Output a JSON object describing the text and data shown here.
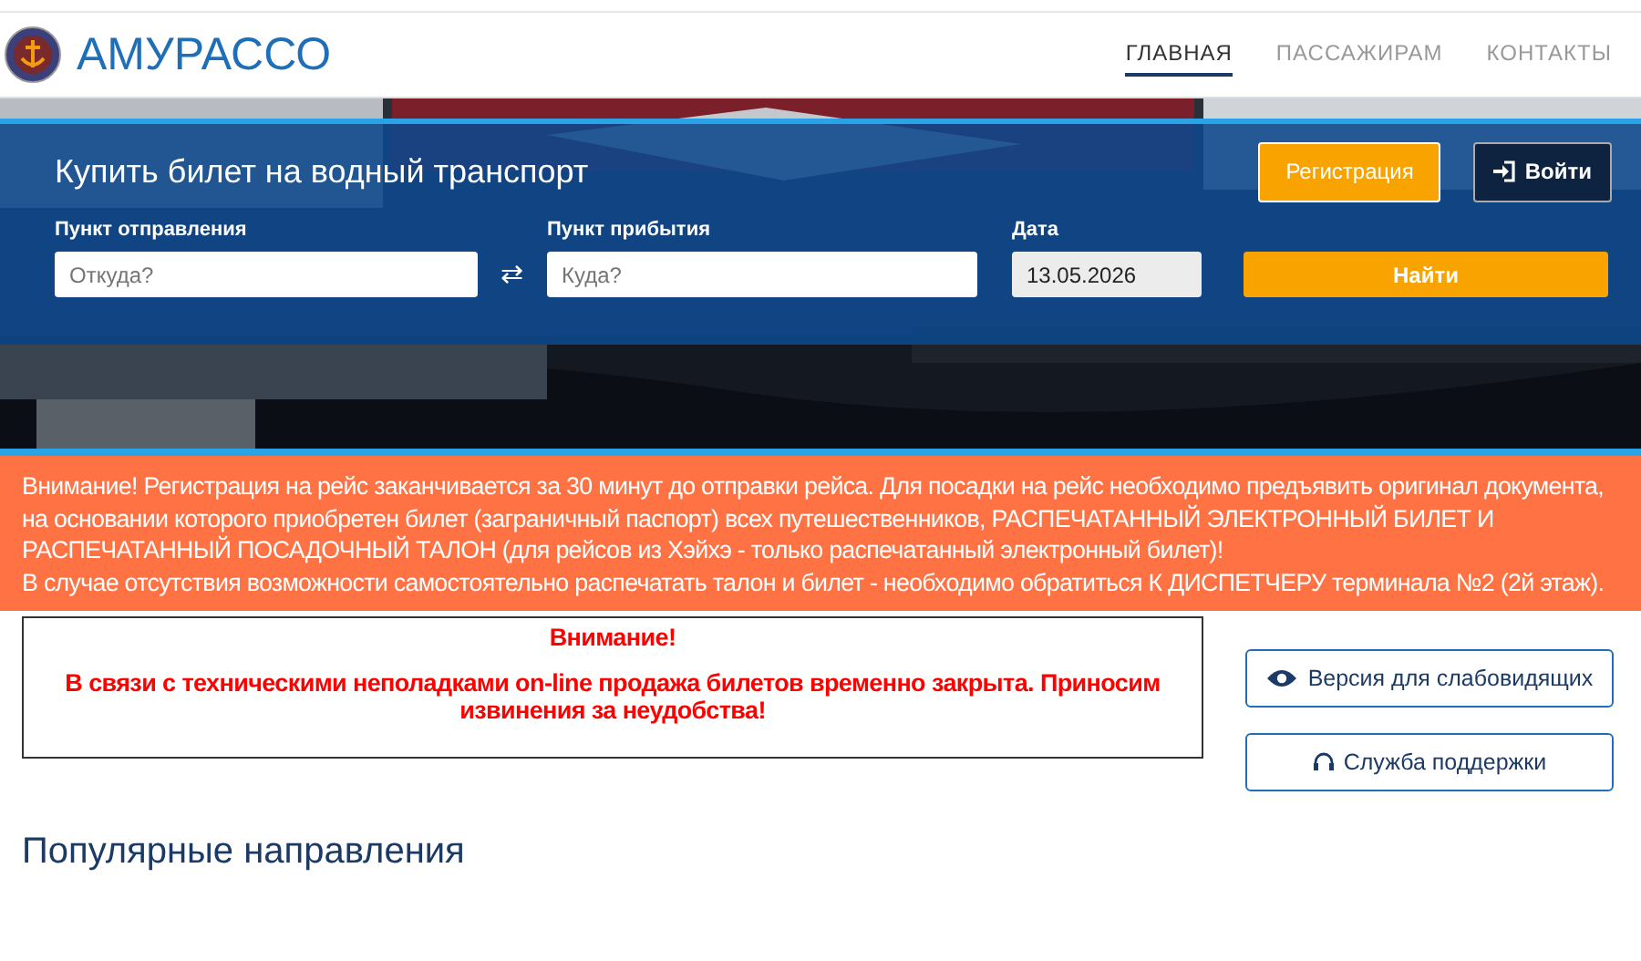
{
  "header": {
    "logo_text": "АМУРАССО",
    "nav": [
      {
        "label": "ГЛАВНАЯ",
        "selected": true
      },
      {
        "label": "ПАССАЖИРАМ",
        "selected": false
      },
      {
        "label": "КОНТАКТЫ",
        "selected": false
      }
    ]
  },
  "search": {
    "title": "Купить билет на водный транспорт",
    "buttons": [
      {
        "label": "Регистрация",
        "kind": "register"
      },
      {
        "label": "Войти",
        "kind": "login"
      }
    ],
    "from": {
      "label": "Пункт отправления",
      "placeholder": "Откуда?"
    },
    "swap": "⇄",
    "to": {
      "label": "Пункт прибытия",
      "placeholder": "Куда?"
    },
    "date": {
      "label": "Дата",
      "value": "13.05.2026"
    },
    "submit": "Найти"
  },
  "notice": [
    "Внимание! Регистрация на рейс заканчивается за 30 минут до отправки рейса. Для посадки на рейс необходимо предъявить оригинал документа, на основании которого приобретен билет (заграничный паспорт) всех путешественников, РАСПЕЧАТАННЫЙ ЭЛЕКТРОННЫЙ БИЛЕТ И РАСПЕЧАТАННЫЙ ПОСАДОЧНЫЙ ТАЛОН (для рейсов из Хэйхэ - только распечатанный электронный билет)!",
    "В случае отсутствия возможности самостоятельно распечатать талон и билет - необходимо обратиться К ДИСПЕТЧЕРУ терминала №2 (2й этаж)."
  ],
  "alert": {
    "title": "Внимание!",
    "text": "В связи с техническими неполадками on-line продажа билетов временно закрыта. Приносим извинения за неудобства!"
  },
  "side_buttons": [
    {
      "label": "Версия для слабовидящих",
      "kind": "eye"
    },
    {
      "label": "Служба поддержки",
      "kind": "headset"
    }
  ],
  "section_title": "Популярные направления"
}
